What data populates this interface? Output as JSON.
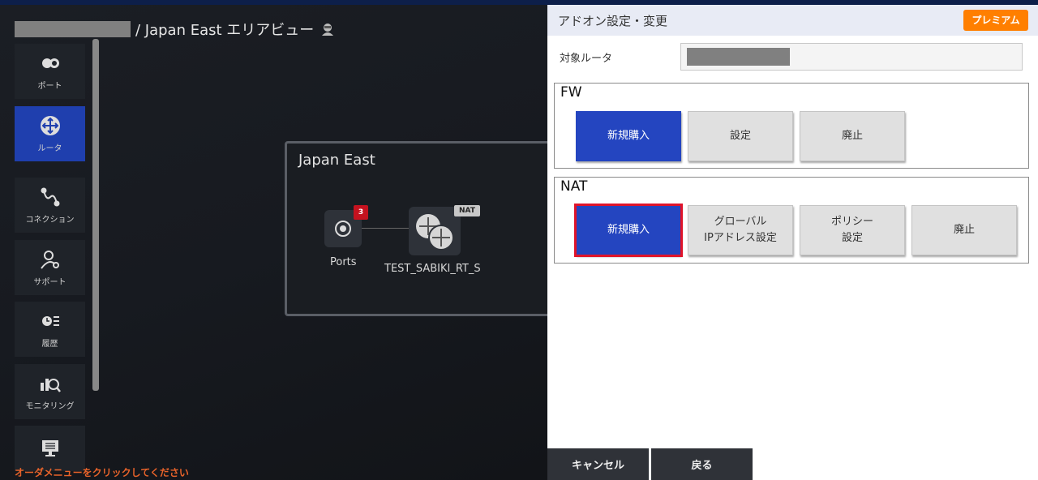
{
  "breadcrumb": {
    "title": "/ Japan East エリアビュー"
  },
  "sidebar": {
    "items": [
      {
        "label": "ポート",
        "icon": "port-icon"
      },
      {
        "label": "ルータ",
        "icon": "router-icon",
        "active": true
      },
      {
        "label": "コネクション",
        "icon": "connection-icon"
      },
      {
        "label": "サポート",
        "icon": "support-icon"
      },
      {
        "label": "履歴",
        "icon": "history-icon"
      },
      {
        "label": "モニタリング",
        "icon": "monitoring-icon"
      },
      {
        "label": "",
        "icon": "order-icon"
      }
    ]
  },
  "order_message": "オーダメニューをクリックしてください",
  "diagram": {
    "area_title": "Japan East",
    "port_label": "Ports",
    "port_count": "3",
    "router_label": "TEST_SABIKI_RT_S",
    "router_badge": "NAT"
  },
  "panel": {
    "title": "アドオン設定・変更",
    "premium_label": "プレミアム",
    "target_router_label": "対象ルータ",
    "fw": {
      "title": "FW",
      "buttons": [
        "新規購入",
        "設定",
        "廃止"
      ]
    },
    "nat": {
      "title": "NAT",
      "buttons": [
        "新規購入",
        "グローバル\nIPアドレス設定",
        "ポリシー\n設定",
        "廃止"
      ]
    },
    "cancel_label": "キャンセル",
    "back_label": "戻る"
  },
  "colors": {
    "primary": "#2445c0",
    "premium": "#ff7f00",
    "highlight": "#e0142a",
    "order_message": "#e8632a"
  }
}
